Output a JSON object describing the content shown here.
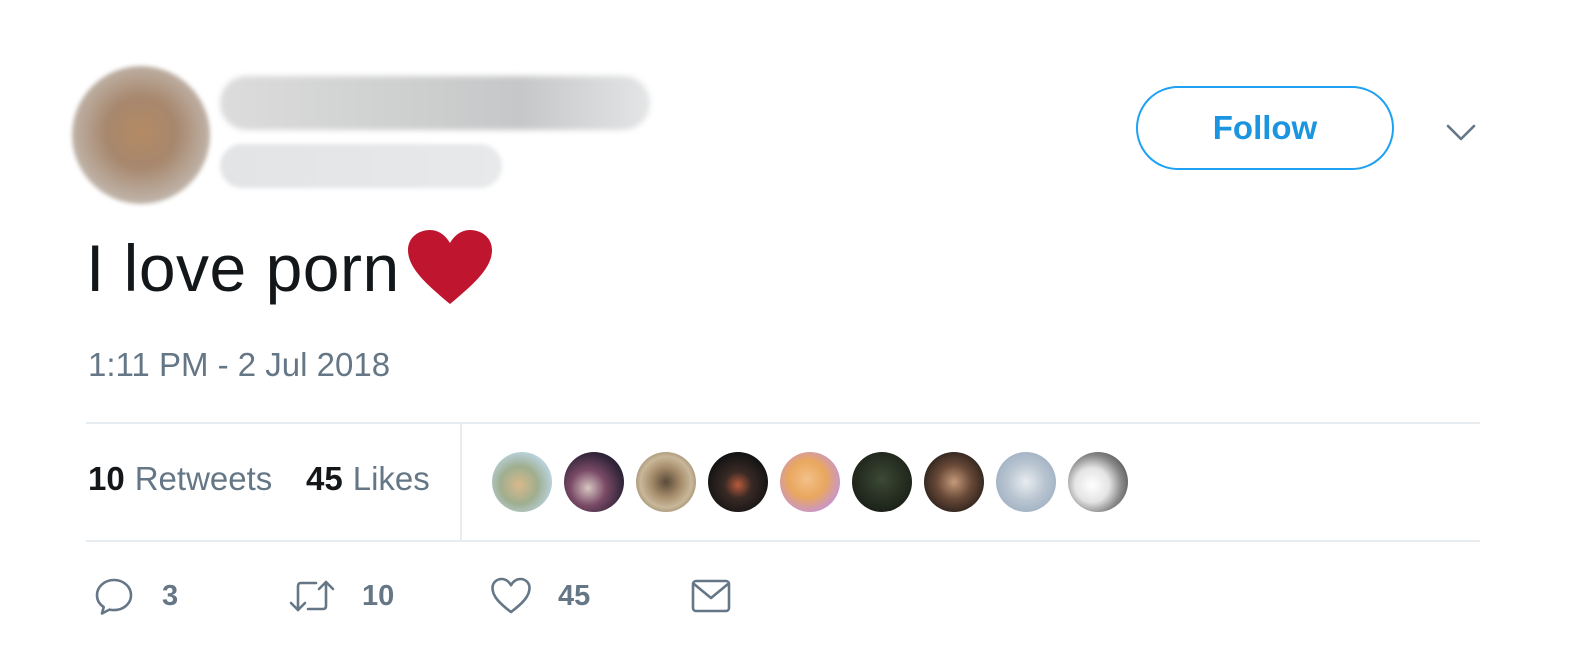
{
  "tweet": {
    "follow_label": "Follow",
    "text": "I love porn",
    "timestamp": "1:11 PM - 2 Jul 2018"
  },
  "stats": {
    "retweets_count": "10",
    "retweets_label": "Retweets",
    "likes_count": "45",
    "likes_label": "Likes"
  },
  "actions": {
    "reply_count": "3",
    "retweet_count": "10",
    "like_count": "45"
  },
  "icons": {
    "caret": "chevron-down-icon",
    "heart_emoji": "red-heart-emoji",
    "reply": "speech-bubble-icon",
    "retweet": "retweet-arrows-icon",
    "like": "heart-outline-icon",
    "dm": "envelope-icon"
  },
  "colors": {
    "accent": "#1da1f2",
    "follow_text": "#1b95e0",
    "secondary_text": "#657786",
    "primary_text": "#14171a",
    "divider": "#e6ecf0",
    "heart_emoji": "#c0152f"
  }
}
